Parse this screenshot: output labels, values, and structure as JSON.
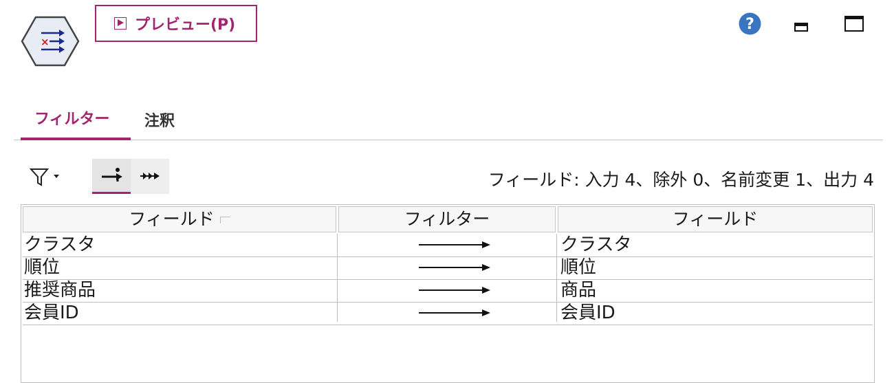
{
  "toolbar": {
    "preview_label": "プレビュー(P)"
  },
  "tabs": [
    {
      "label": "フィルター",
      "active": true
    },
    {
      "label": "注釈",
      "active": false
    }
  ],
  "summary_text": "フィールド: 入力 4、除外 0、名前変更 1、出力 4",
  "table": {
    "headers": [
      "フィールド",
      "フィルター",
      "フィールド"
    ],
    "rows": [
      {
        "field": "クラスタ",
        "filter": "pass-arrow",
        "output": "クラスタ"
      },
      {
        "field": "順位",
        "filter": "pass-arrow",
        "output": "順位"
      },
      {
        "field": "推奨商品",
        "filter": "pass-arrow",
        "output": "商品"
      },
      {
        "field": "会員ID",
        "filter": "pass-arrow",
        "output": "会員ID"
      }
    ]
  },
  "icons": {
    "node": "filter-node-icon",
    "preview": "play-icon",
    "help": "help-icon",
    "minimize": "minimize-icon",
    "maximize": "maximize-icon",
    "funnel": "funnel-filter-icon",
    "tool_a": "pass-fields-icon",
    "tool_b": "pass-all-icon"
  },
  "colors": {
    "accent": "#a3246e",
    "help_blue": "#3a75c4"
  }
}
